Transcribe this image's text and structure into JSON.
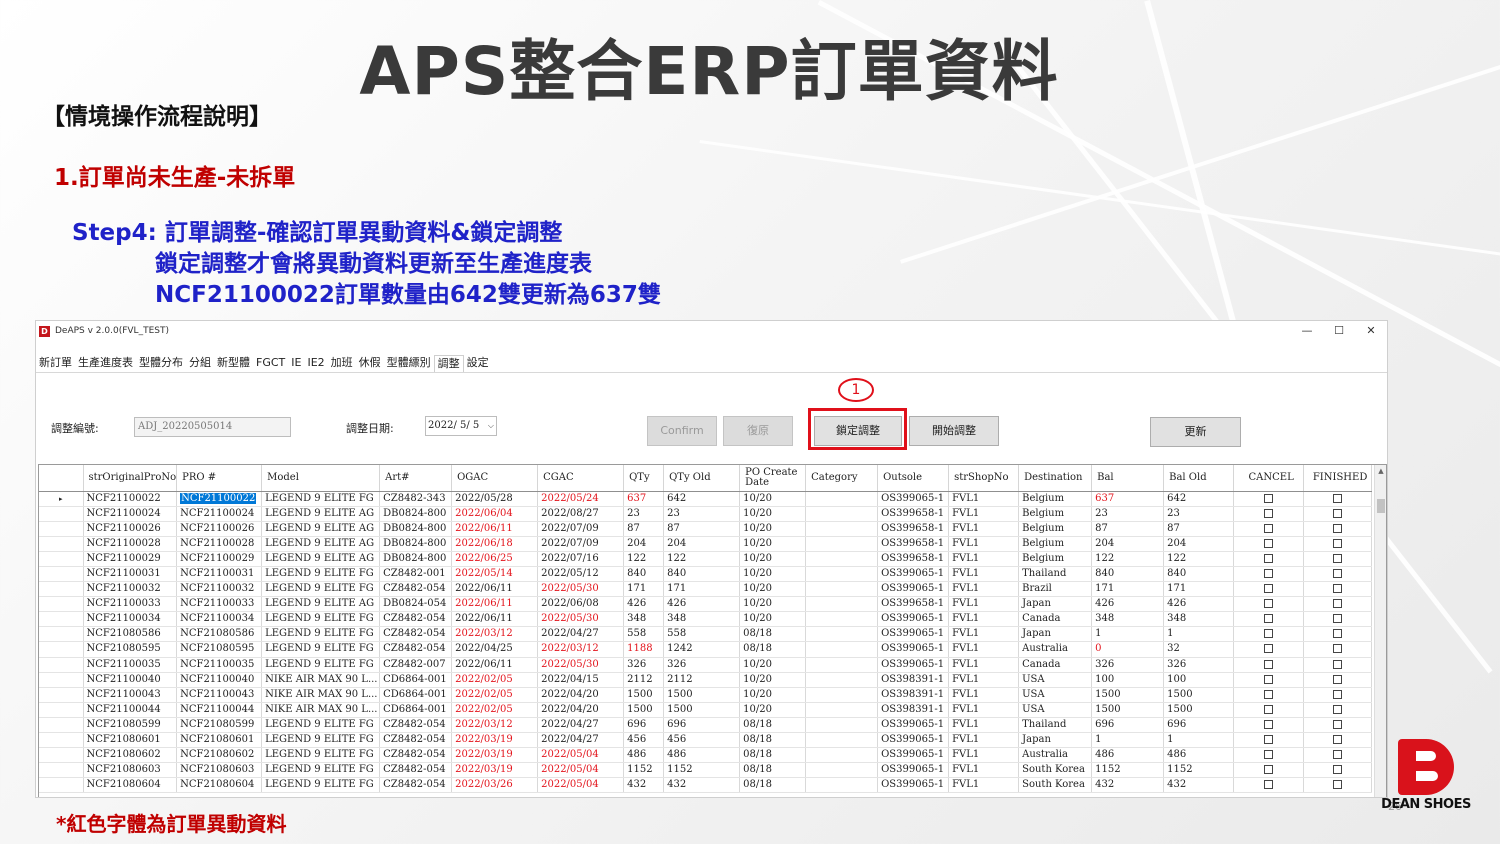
{
  "slide": {
    "title": "APS整合ERP訂單資料",
    "section": "【情境操作流程說明】",
    "case": "1.訂單尚未生產-未拆單",
    "step_line1": "Step4: 訂單調整-確認訂單異動資料&鎖定調整",
    "step_line2": "鎖定調整才會將異動資料更新至生產進度表",
    "step_line3": "NCF21100022訂單數量由642雙更新為637雙",
    "footnote": "*紅色字體為訂單異動資料",
    "page_number": "26",
    "logo_text": "DEAN SHOES",
    "marker": "1",
    "colors": {
      "red_text": "#c00000",
      "blue_text": "#1f22c8",
      "changed_value": "#e3141c",
      "highlight": "#e0101a",
      "selected_cell": "#0078d7"
    }
  },
  "window": {
    "title": "DeAPS v 2.0.0(FVL_TEST)",
    "icon": "app-logo-icon",
    "controls": {
      "minimize": "—",
      "maximize": "☐",
      "close": "✕"
    }
  },
  "menu": [
    "新訂單",
    "生產進度表",
    "型體分布",
    "分組",
    "新型體",
    "FGCT",
    "IE",
    "IE2",
    "加班",
    "休假",
    "型體縹別",
    "調整",
    "設定"
  ],
  "menu_selected": "調整",
  "form": {
    "adjust_no_label": "調整編號:",
    "adjust_no_value": "ADJ_20220505014",
    "adjust_date_label": "調整日期:",
    "adjust_date_value": "2022/ 5/ 5",
    "confirm_label": "Confirm",
    "restore_label": "復原",
    "lock_label": "鎖定調整",
    "start_label": "開始調整",
    "refresh_label": "更新"
  },
  "grid": {
    "columns": [
      "strOriginalProNo",
      "PRO #",
      "Model",
      "Art#",
      "OGAC",
      "CGAC",
      "QTy",
      "QTy Old",
      "PO Create Date",
      "Category",
      "Outsole",
      "strShopNo",
      "Destination",
      "Bal",
      "Bal Old",
      "CANCEL",
      "FINISHED"
    ],
    "row_pointer": "▸",
    "rows": [
      [
        "NCF21100022",
        "NCF21100022",
        "LEGEND 9 ELITE FG",
        "CZ8482-343",
        "2022/05/28",
        "2022/05/24",
        "637",
        "642",
        "10/20",
        "",
        "OS399065-1",
        "FVL1",
        "Belgium",
        "637",
        "642"
      ],
      [
        "NCF21100024",
        "NCF21100024",
        "LEGEND 9 ELITE AG",
        "DB0824-800",
        "2022/06/04",
        "2022/08/27",
        "23",
        "23",
        "10/20",
        "",
        "OS399658-1",
        "FVL1",
        "Belgium",
        "23",
        "23"
      ],
      [
        "NCF21100026",
        "NCF21100026",
        "LEGEND 9 ELITE AG",
        "DB0824-800",
        "2022/06/11",
        "2022/07/09",
        "87",
        "87",
        "10/20",
        "",
        "OS399658-1",
        "FVL1",
        "Belgium",
        "87",
        "87"
      ],
      [
        "NCF21100028",
        "NCF21100028",
        "LEGEND 9 ELITE AG",
        "DB0824-800",
        "2022/06/18",
        "2022/07/09",
        "204",
        "204",
        "10/20",
        "",
        "OS399658-1",
        "FVL1",
        "Belgium",
        "204",
        "204"
      ],
      [
        "NCF21100029",
        "NCF21100029",
        "LEGEND 9 ELITE AG",
        "DB0824-800",
        "2022/06/25",
        "2022/07/16",
        "122",
        "122",
        "10/20",
        "",
        "OS399658-1",
        "FVL1",
        "Belgium",
        "122",
        "122"
      ],
      [
        "NCF21100031",
        "NCF21100031",
        "LEGEND 9 ELITE FG",
        "CZ8482-001",
        "2022/05/14",
        "2022/05/12",
        "840",
        "840",
        "10/20",
        "",
        "OS399065-1",
        "FVL1",
        "Thailand",
        "840",
        "840"
      ],
      [
        "NCF21100032",
        "NCF21100032",
        "LEGEND 9 ELITE FG",
        "CZ8482-054",
        "2022/06/11",
        "2022/05/30",
        "171",
        "171",
        "10/20",
        "",
        "OS399065-1",
        "FVL1",
        "Brazil",
        "171",
        "171"
      ],
      [
        "NCF21100033",
        "NCF21100033",
        "LEGEND 9 ELITE AG",
        "DB0824-054",
        "2022/06/11",
        "2022/06/08",
        "426",
        "426",
        "10/20",
        "",
        "OS399658-1",
        "FVL1",
        "Japan",
        "426",
        "426"
      ],
      [
        "NCF21100034",
        "NCF21100034",
        "LEGEND 9 ELITE FG",
        "CZ8482-054",
        "2022/06/11",
        "2022/05/30",
        "348",
        "348",
        "10/20",
        "",
        "OS399065-1",
        "FVL1",
        "Canada",
        "348",
        "348"
      ],
      [
        "NCF21080586",
        "NCF21080586",
        "LEGEND 9 ELITE FG",
        "CZ8482-054",
        "2022/03/12",
        "2022/04/27",
        "558",
        "558",
        "08/18",
        "",
        "OS399065-1",
        "FVL1",
        "Japan",
        "1",
        "1"
      ],
      [
        "NCF21080595",
        "NCF21080595",
        "LEGEND 9 ELITE FG",
        "CZ8482-054",
        "2022/04/25",
        "2022/03/12",
        "1188",
        "1242",
        "08/18",
        "",
        "OS399065-1",
        "FVL1",
        "Australia",
        "0",
        "32"
      ],
      [
        "NCF21100035",
        "NCF21100035",
        "LEGEND 9 ELITE FG",
        "CZ8482-007",
        "2022/06/11",
        "2022/05/30",
        "326",
        "326",
        "10/20",
        "",
        "OS399065-1",
        "FVL1",
        "Canada",
        "326",
        "326"
      ],
      [
        "NCF21100040",
        "NCF21100040",
        "NIKE AIR MAX 90 L...",
        "CD6864-001",
        "2022/02/05",
        "2022/04/15",
        "2112",
        "2112",
        "10/20",
        "",
        "OS398391-1",
        "FVL1",
        "USA",
        "100",
        "100"
      ],
      [
        "NCF21100043",
        "NCF21100043",
        "NIKE AIR MAX 90 L...",
        "CD6864-001",
        "2022/02/05",
        "2022/04/20",
        "1500",
        "1500",
        "10/20",
        "",
        "OS398391-1",
        "FVL1",
        "USA",
        "1500",
        "1500"
      ],
      [
        "NCF21100044",
        "NCF21100044",
        "NIKE AIR MAX 90 L...",
        "CD6864-001",
        "2022/02/05",
        "2022/04/20",
        "1500",
        "1500",
        "10/20",
        "",
        "OS398391-1",
        "FVL1",
        "USA",
        "1500",
        "1500"
      ],
      [
        "NCF21080599",
        "NCF21080599",
        "LEGEND 9 ELITE FG",
        "CZ8482-054",
        "2022/03/12",
        "2022/04/27",
        "696",
        "696",
        "08/18",
        "",
        "OS399065-1",
        "FVL1",
        "Thailand",
        "696",
        "696"
      ],
      [
        "NCF21080601",
        "NCF21080601",
        "LEGEND 9 ELITE FG",
        "CZ8482-054",
        "2022/03/19",
        "2022/04/27",
        "456",
        "456",
        "08/18",
        "",
        "OS399065-1",
        "FVL1",
        "Japan",
        "1",
        "1"
      ],
      [
        "NCF21080602",
        "NCF21080602",
        "LEGEND 9 ELITE FG",
        "CZ8482-054",
        "2022/03/19",
        "2022/05/04",
        "486",
        "486",
        "08/18",
        "",
        "OS399065-1",
        "FVL1",
        "Australia",
        "486",
        "486"
      ],
      [
        "NCF21080603",
        "NCF21080603",
        "LEGEND 9 ELITE FG",
        "CZ8482-054",
        "2022/03/19",
        "2022/05/04",
        "1152",
        "1152",
        "08/18",
        "",
        "OS399065-1",
        "FVL1",
        "South Korea",
        "1152",
        "1152"
      ],
      [
        "NCF21080604",
        "NCF21080604",
        "LEGEND 9 ELITE FG",
        "CZ8482-054",
        "2022/03/26",
        "2022/05/04",
        "432",
        "432",
        "08/18",
        "",
        "OS399065-1",
        "FVL1",
        "South Korea",
        "432",
        "432"
      ]
    ],
    "red_cells": [
      [
        0,
        5
      ],
      [
        0,
        6
      ],
      [
        0,
        13
      ],
      [
        1,
        4
      ],
      [
        2,
        4
      ],
      [
        3,
        4
      ],
      [
        4,
        4
      ],
      [
        5,
        4
      ],
      [
        6,
        5
      ],
      [
        7,
        4
      ],
      [
        8,
        5
      ],
      [
        9,
        4
      ],
      [
        10,
        5
      ],
      [
        10,
        6
      ],
      [
        10,
        13
      ],
      [
        11,
        5
      ],
      [
        12,
        4
      ],
      [
        13,
        4
      ],
      [
        14,
        4
      ],
      [
        15,
        4
      ],
      [
        16,
        4
      ],
      [
        17,
        4
      ],
      [
        17,
        5
      ],
      [
        18,
        4
      ],
      [
        18,
        5
      ],
      [
        19,
        4
      ],
      [
        19,
        5
      ]
    ],
    "selected_cell": [
      0,
      1
    ]
  }
}
